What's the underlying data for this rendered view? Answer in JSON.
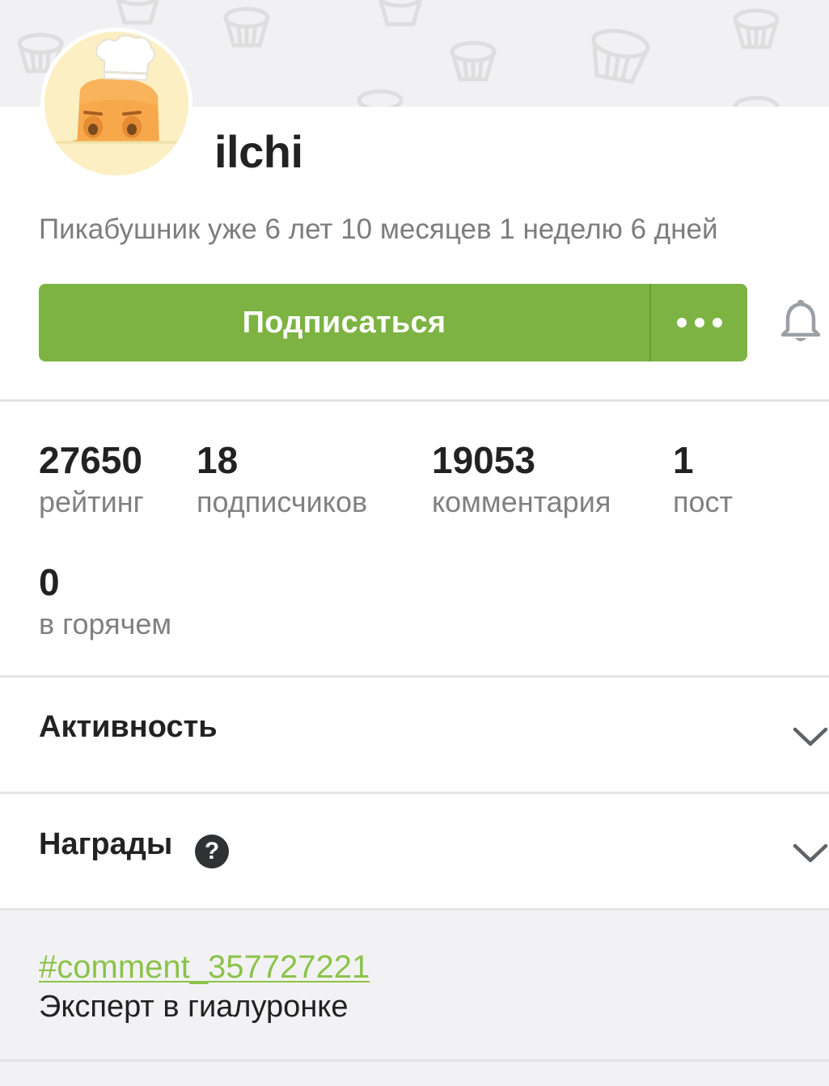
{
  "profile": {
    "username": "ilchi",
    "tenure": "Пикабушник уже 6 лет 10 месяцев 1 неделю 6 дней",
    "avatar_icon": "chef-potato-avatar-icon"
  },
  "actions": {
    "subscribe_label": "Подписаться",
    "more_icon": "more-dots-icon",
    "bell_icon": "bell-icon"
  },
  "stats": [
    {
      "value": "27650",
      "label": "рейтинг"
    },
    {
      "value": "18",
      "label": "подписчиков"
    },
    {
      "value": "19053",
      "label": "комментария"
    },
    {
      "value": "1",
      "label": "пост"
    },
    {
      "value": "0",
      "label": "в горячем"
    }
  ],
  "sections": {
    "activity": {
      "title": "Активность",
      "icon": "chevron-down-icon"
    },
    "awards": {
      "title": "Награды",
      "help_glyph": "?",
      "icon": "chevron-down-icon"
    }
  },
  "note": {
    "link": "#comment_357727221",
    "text": "Эксперт в гиалуронке"
  },
  "colors": {
    "accent": "#7cb342",
    "link": "#8bc34a"
  }
}
